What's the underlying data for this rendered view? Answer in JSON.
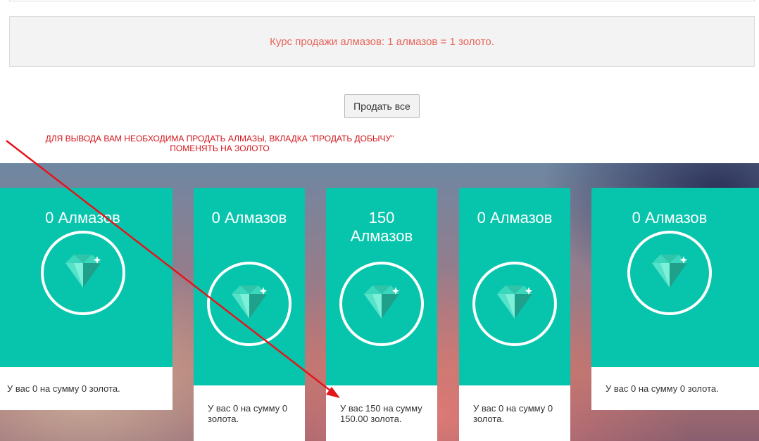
{
  "rate": {
    "text": "Курс продажи алмазов: 1 алмазов = 1 золото."
  },
  "actions": {
    "sell_all_label": "Продать все"
  },
  "note": {
    "line1": "ДЛЯ ВЫВОДА ВАМ НЕОБХОДИМА ПРОДАТЬ АЛМАЗЫ, ВКЛАДКА \"ПРОДАТЬ ДОБЫЧУ\"",
    "line2": "ПОМЕНЯТЬ НА ЗОЛОТО"
  },
  "cards": [
    {
      "title": "0 Алмазов",
      "footer": "У вас 0 на сумму 0 золота."
    },
    {
      "title": "0 Алмазов",
      "footer": "У вас 0 на сумму 0 золота."
    },
    {
      "title": "150 Алмазов",
      "footer": "У вас 150 на сумму 150.00 золота."
    },
    {
      "title": "0 Алмазов",
      "footer": "У вас 0 на сумму 0 золота."
    },
    {
      "title": "0 Алмазов",
      "footer": "У вас 0 на сумму 0 золота."
    }
  ],
  "colors": {
    "card": "#07c5ad",
    "accent_text": "#e8655a",
    "annotation": "#d4141b"
  },
  "icons": {
    "card_icon": "diamond-icon"
  }
}
